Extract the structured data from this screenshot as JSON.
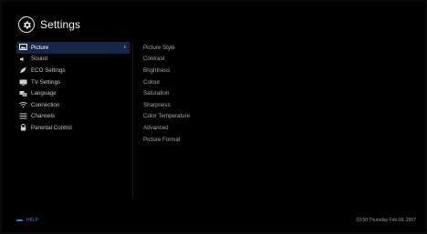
{
  "header": {
    "title": "Settings",
    "icon": "gear-icon"
  },
  "menu": {
    "items": [
      {
        "label": "Picture",
        "icon": "picture-icon",
        "selected": true
      },
      {
        "label": "Sound",
        "icon": "speaker-icon"
      },
      {
        "label": "ECO Settings",
        "icon": "leaf-icon"
      },
      {
        "label": "TV Settings",
        "icon": "tv-icon"
      },
      {
        "label": "Language",
        "icon": "language-icon"
      },
      {
        "label": "Connection",
        "icon": "wifi-icon"
      },
      {
        "label": "Channels",
        "icon": "list-icon"
      },
      {
        "label": "Parental Control",
        "icon": "lock-icon"
      }
    ]
  },
  "submenu": {
    "items": [
      "Picture Style",
      "Contrast",
      "Brightness",
      "Colour",
      "Saturation",
      "Sharpness",
      "Color Temperature",
      "Advanced",
      "Picture Format"
    ]
  },
  "footer": {
    "help": "HELP",
    "datetime": "03:50 Thursday Feb.08, 2007"
  },
  "colors": {
    "selected_bg": "#17254a",
    "help_accent": "#2d7ee8"
  }
}
